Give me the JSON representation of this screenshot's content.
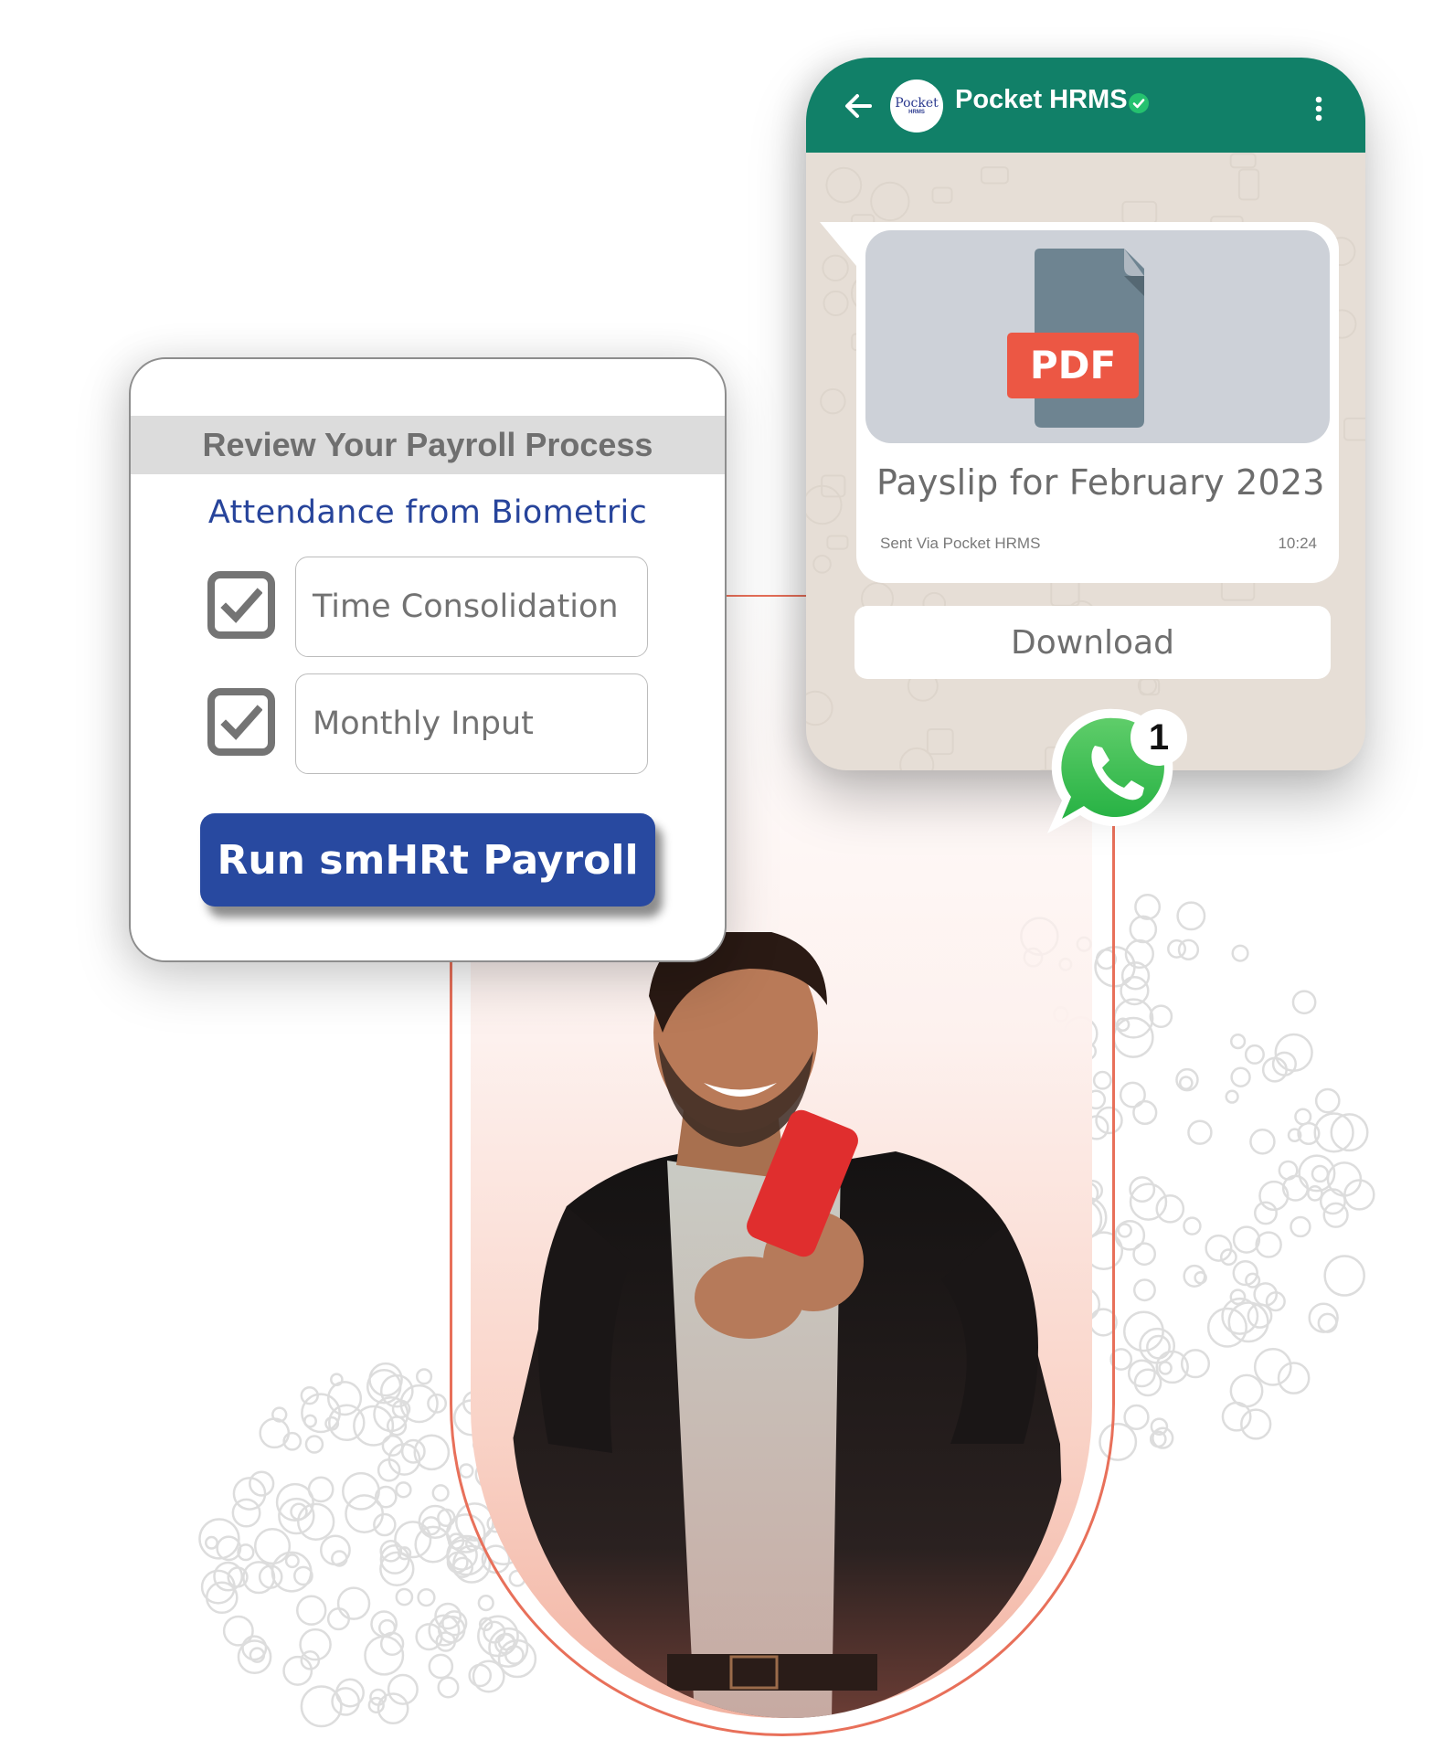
{
  "colors": {
    "whatsapp_header": "#118068",
    "chat_background": "#e6ded6",
    "primary_button": "#2849a0",
    "subtitle_blue": "#27449b",
    "accent_coral": "#e8705a",
    "pdf_red": "#ec5744",
    "whatsapp_green": "#3cbf4f"
  },
  "payroll_card": {
    "title": "Review Your Payroll Process",
    "subtitle": "Attendance from Biometric",
    "steps": [
      {
        "label": "Time Consolidation",
        "checked": true,
        "icon": "checkbox-checked-icon"
      },
      {
        "label": "Monthly Input",
        "checked": true,
        "icon": "checkbox-checked-icon"
      }
    ],
    "action_button": "Run smHRt Payroll"
  },
  "chat": {
    "back_icon": "arrow-left-icon",
    "avatar": {
      "logo_top": "Pocket",
      "logo_bottom": "HRMS"
    },
    "contact_name": "Pocket HRMS",
    "verified_icon": "verified-badge-icon",
    "menu_icon": "more-vertical-icon",
    "message": {
      "attachment_type": "PDF",
      "title": "Payslip for February 2023",
      "footer": "Sent Via Pocket HRMS",
      "time": "10:24"
    },
    "download_button": "Download"
  },
  "whatsapp_badge": {
    "icon": "whatsapp-icon",
    "unread_count": "1"
  },
  "illustration": {
    "subject": "smiling man holding red phone"
  }
}
